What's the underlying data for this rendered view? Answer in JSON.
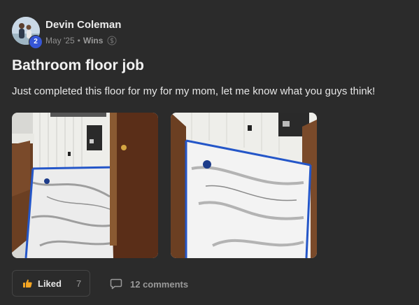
{
  "author": {
    "name": "Devin Coleman",
    "level": "2"
  },
  "meta": {
    "date": "May '25",
    "separator": "•",
    "category": "Wins"
  },
  "post": {
    "title": "Bathroom floor job",
    "body": "Just completed this floor for my for my mom, let me know what you guys think!"
  },
  "images": [
    {
      "name": "bathroom-floor-photo-doorway"
    },
    {
      "name": "bathroom-floor-photo-corner"
    }
  ],
  "actions": {
    "like_label": "Liked",
    "like_count": "7",
    "comments_label": "12 comments"
  },
  "icons": {
    "like": "thumbs-up-icon",
    "comment": "comment-bubble-icon",
    "category": "dollar-icon"
  },
  "colors": {
    "background": "#2b2b2b",
    "badge": "#3656d6",
    "like_accent": "#f5a623"
  }
}
